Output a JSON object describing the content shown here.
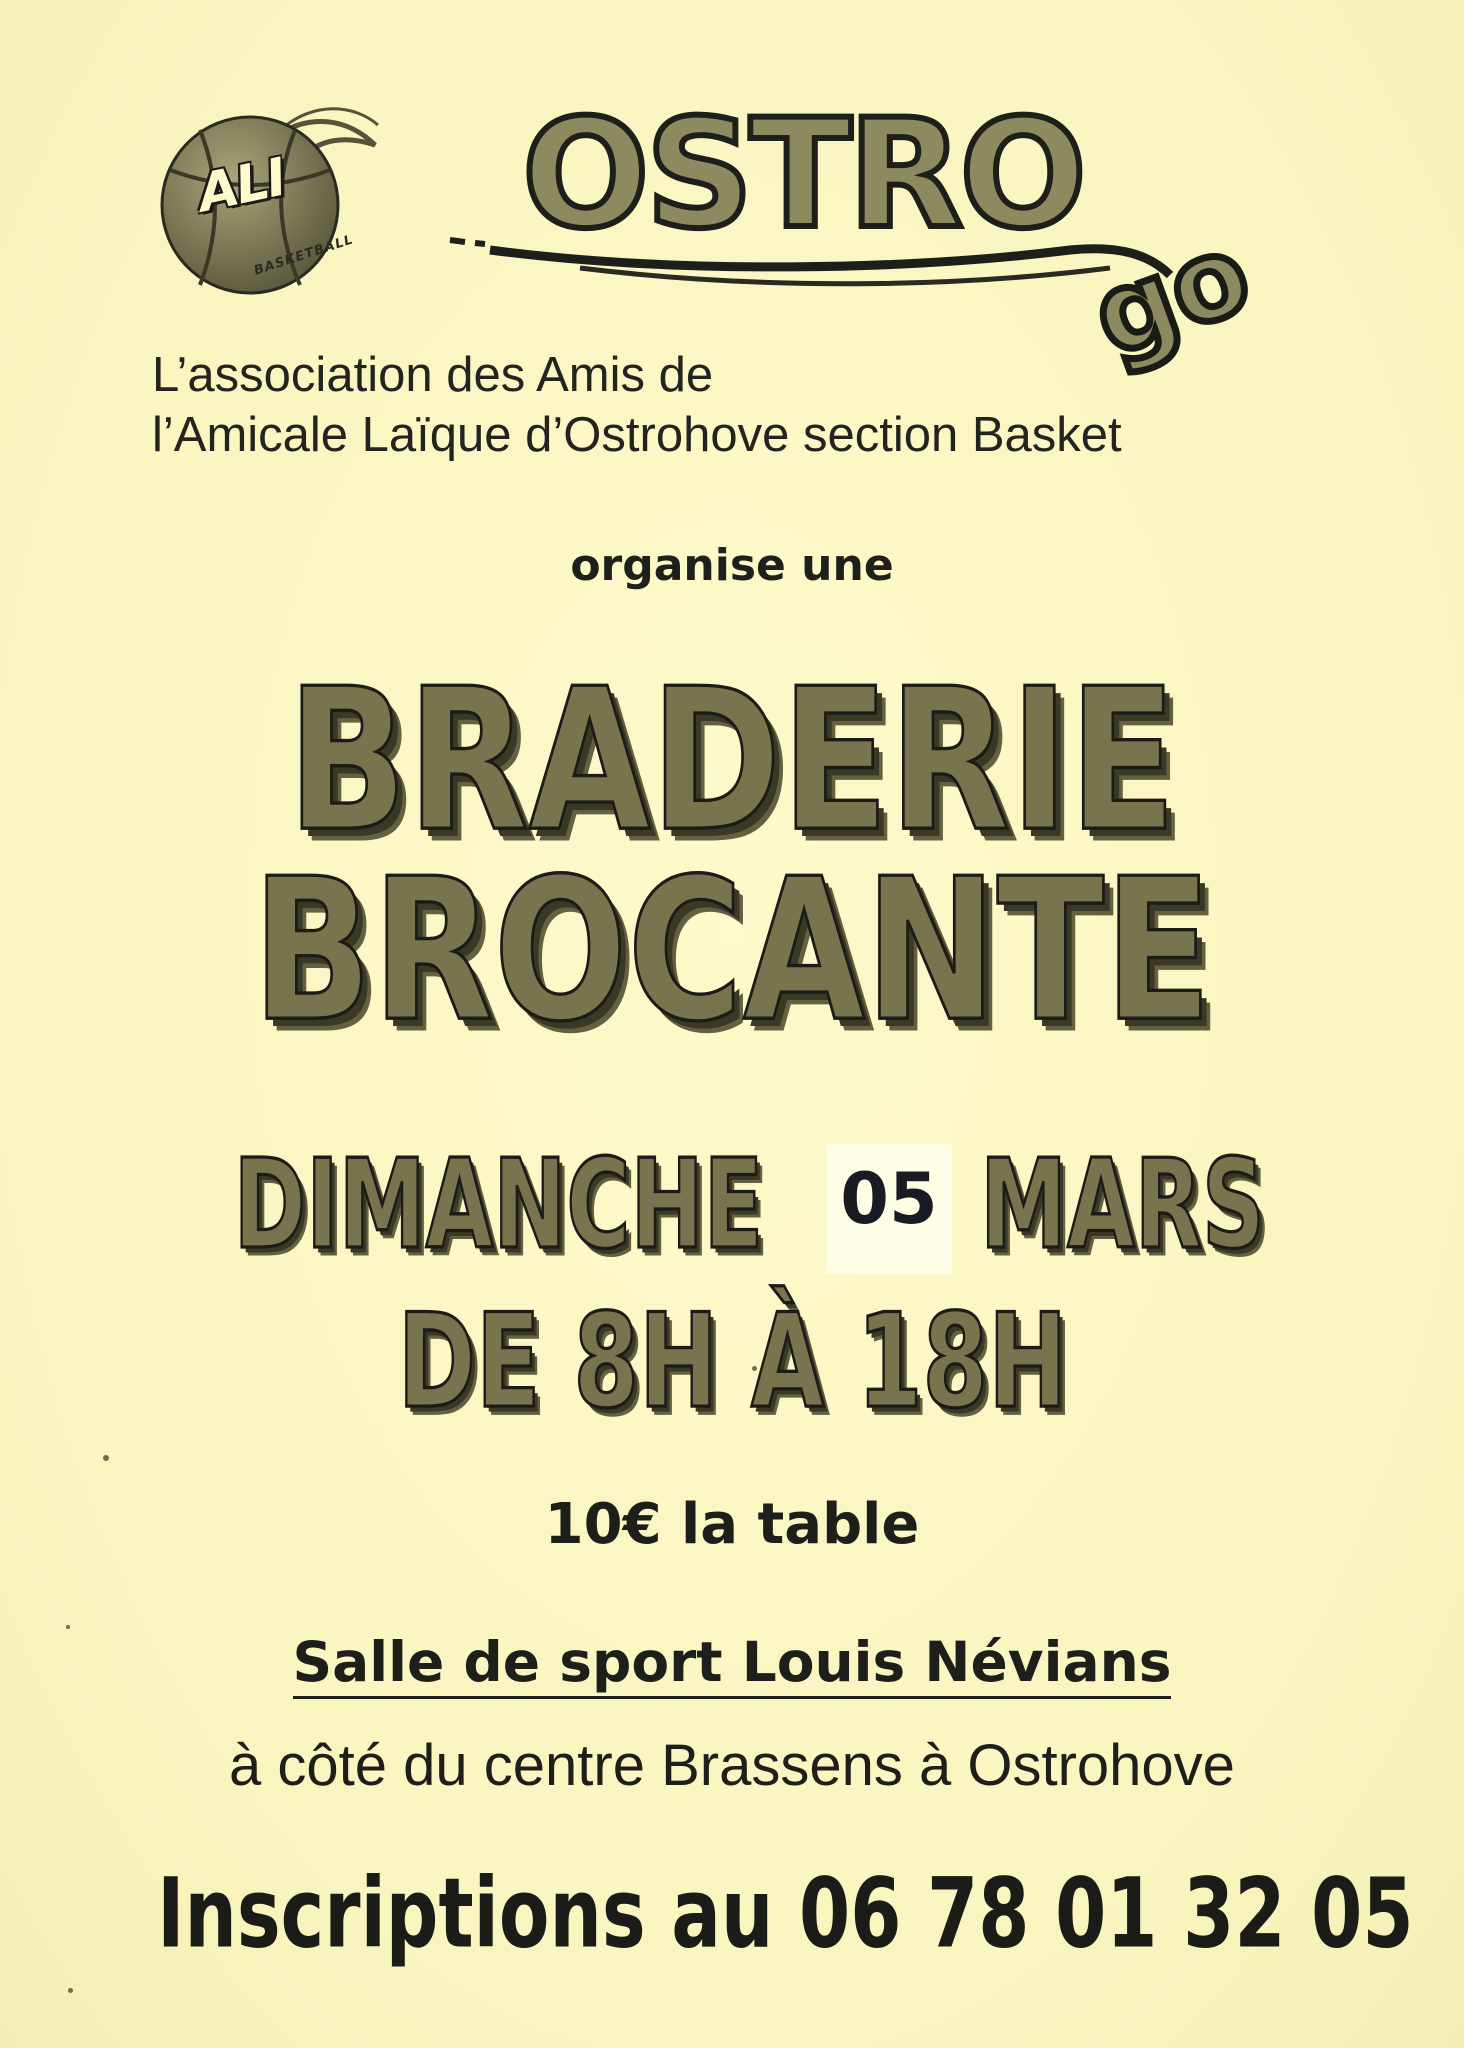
{
  "logos": {
    "ali": {
      "text": "ALI",
      "subtext": "BASKETBALL"
    },
    "ostro": {
      "text": "OSTRO",
      "suffix": "go"
    }
  },
  "association": {
    "line1": "L’association des Amis de",
    "line2": "l’Amicale Laïque d’Ostrohove section Basket"
  },
  "intro": "organise une",
  "event": {
    "title_line1": "BRADERIE",
    "title_line2": "BROCANTE"
  },
  "date": {
    "weekday": "DIMANCHE",
    "day": "05",
    "month": "MARS",
    "hours": "DE 8H À 18H"
  },
  "price": "10€ la table",
  "venue": {
    "name": "Salle de sport Louis Névians",
    "location": "à côté du centre Brassens à Ostrohove"
  },
  "registration": "Inscriptions au 06 78 01 32 05",
  "colors": {
    "paper": "#fbf8c4",
    "ink": "#1e1e1a",
    "headline_fill": "#77744e"
  }
}
